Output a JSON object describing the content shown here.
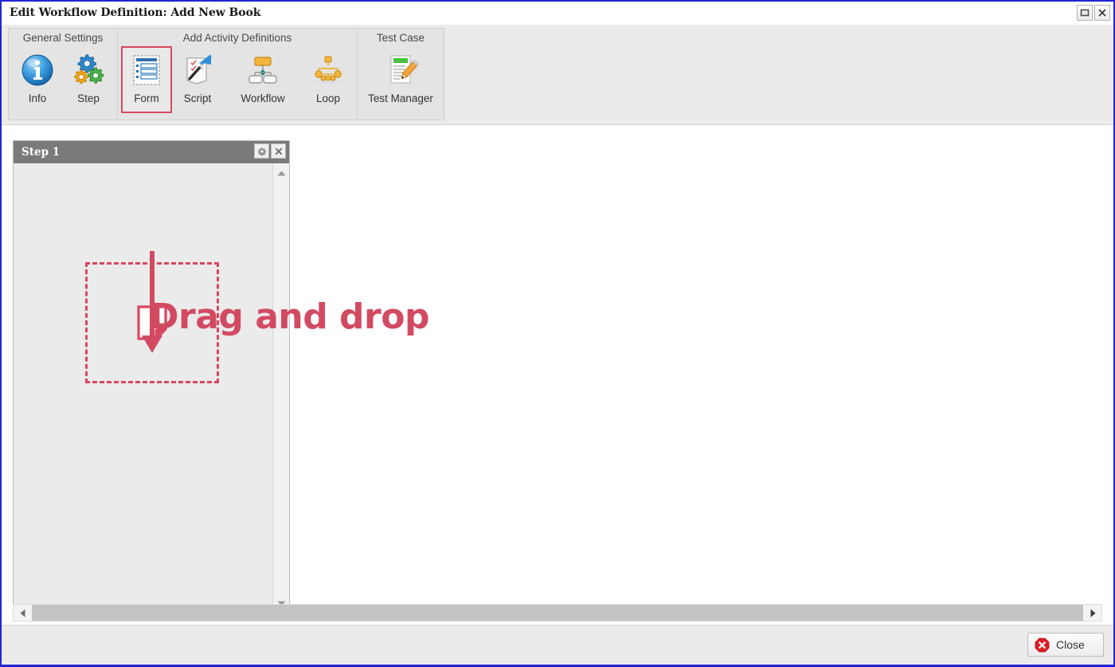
{
  "window": {
    "title": "Edit Workflow Definition: Add New Book",
    "controls": {
      "restore": "restore-button",
      "close": "close-button"
    }
  },
  "ribbon": {
    "groups": [
      {
        "title": "General Settings",
        "items": [
          {
            "label": "Info",
            "icon": "info-icon",
            "selected": false
          },
          {
            "label": "Step",
            "icon": "gears-icon",
            "selected": false
          }
        ]
      },
      {
        "title": "Add Activity Definitions",
        "items": [
          {
            "label": "Form",
            "icon": "form-icon",
            "selected": true
          },
          {
            "label": "Script",
            "icon": "script-icon",
            "selected": false
          },
          {
            "label": "Workflow",
            "icon": "workflow-icon",
            "selected": false
          },
          {
            "label": "Loop",
            "icon": "loop-icon",
            "selected": false
          }
        ]
      },
      {
        "title": "Test Case",
        "items": [
          {
            "label": "Test Manager",
            "icon": "test-manager-icon",
            "selected": false
          }
        ]
      }
    ]
  },
  "workspace": {
    "step_panel": {
      "title": "Step 1",
      "settings_icon": "gear-icon",
      "close_icon": "close-icon",
      "dropzone": {
        "icon": "document-icon"
      }
    },
    "annotation": {
      "text": "Drag and drop",
      "color": "#d24a62"
    },
    "scrollbars": {
      "vertical_up": "scroll-up-arrow",
      "vertical_down": "scroll-down-arrow",
      "horizontal_left": "scroll-left-arrow",
      "horizontal_right": "scroll-right-arrow"
    }
  },
  "footer": {
    "close_label": "Close",
    "close_icon": "red-x-icon"
  },
  "colors": {
    "accent_red": "#d24a62",
    "window_border": "#2323d8",
    "panel_header": "#7a7a7a",
    "ribbon_bg": "#ebebeb"
  }
}
